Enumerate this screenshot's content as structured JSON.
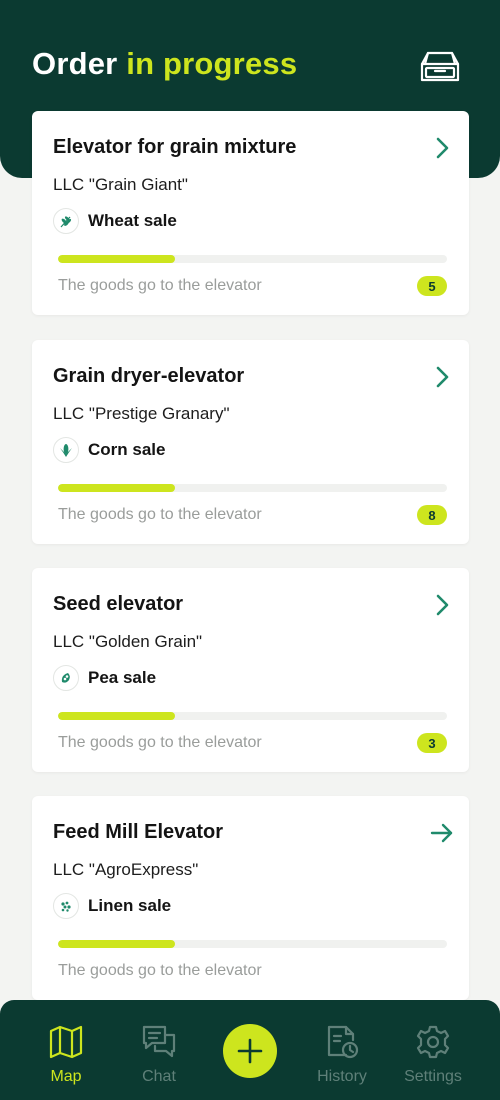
{
  "header": {
    "title_main": "Order",
    "title_accent": "in progress",
    "archive_icon": "archive-box-icon"
  },
  "colors": {
    "dark_green": "#0b3a31",
    "accent_lime": "#cde51e",
    "teal": "#1f8a6b"
  },
  "orders": [
    {
      "title": "Elevator for grain mixture",
      "company": "LLC \"Grain Giant\"",
      "crop": "Wheat sale",
      "crop_icon": "wheat-icon",
      "progress": 0.3,
      "status": "The goods go to the elevator",
      "badge": "5",
      "arrow_icon": "chevron-right-icon"
    },
    {
      "title": "Grain dryer-elevator",
      "company": "LLC \"Prestige Granary\"",
      "crop": "Corn sale",
      "crop_icon": "corn-icon",
      "progress": 0.3,
      "status": "The goods go to the elevator",
      "badge": "8",
      "arrow_icon": "chevron-right-icon"
    },
    {
      "title": "Seed elevator",
      "company": "LLC \"Golden Grain\"",
      "crop": "Pea sale",
      "crop_icon": "pea-icon",
      "progress": 0.3,
      "status": "The goods go to the elevator",
      "badge": "3",
      "arrow_icon": "chevron-right-icon"
    },
    {
      "title": "Feed Mill Elevator",
      "company": "LLC \"AgroExpress\"",
      "crop": "Linen sale",
      "crop_icon": "linen-icon",
      "progress": 0.3,
      "status": "The goods go to the elevator",
      "badge": "",
      "arrow_icon": "arrow-right-icon"
    }
  ],
  "nav": {
    "items": [
      {
        "label": "Map",
        "icon": "map-icon",
        "active": true
      },
      {
        "label": "Chat",
        "icon": "chat-icon",
        "active": false
      },
      {
        "label": "",
        "icon": "plus-icon",
        "active": false
      },
      {
        "label": "History",
        "icon": "history-icon",
        "active": false
      },
      {
        "label": "Settings",
        "icon": "gear-icon",
        "active": false
      }
    ]
  }
}
